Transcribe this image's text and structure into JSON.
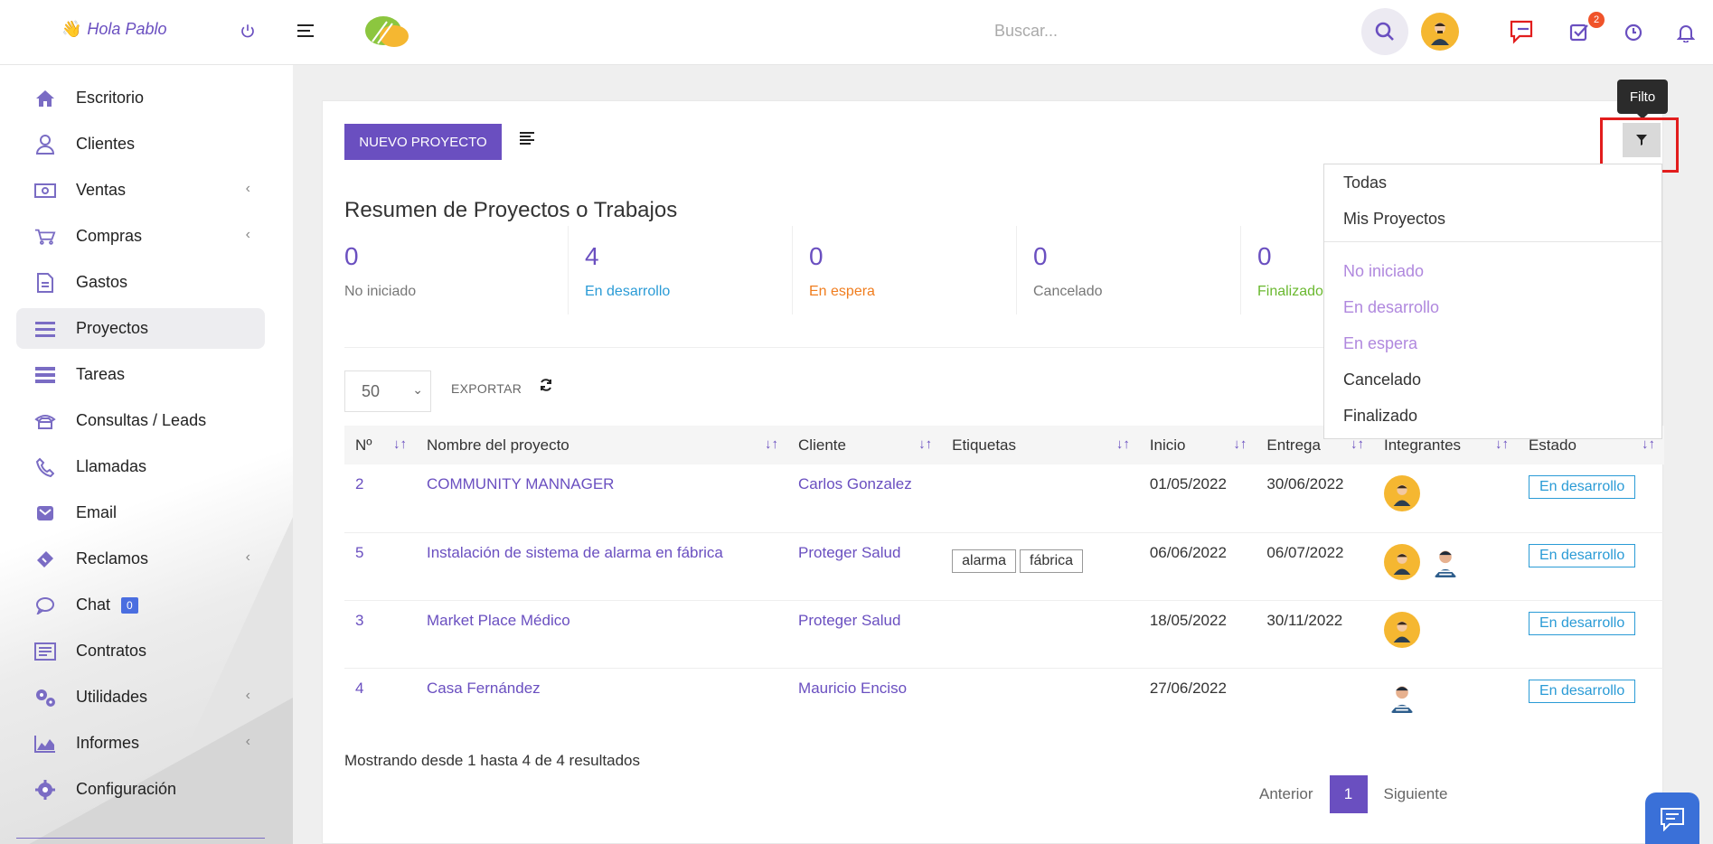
{
  "header": {
    "greeting": "Hola Pablo",
    "search_placeholder": "Buscar...",
    "tasks_badge": "2"
  },
  "sidebar": {
    "items": [
      {
        "label": "Escritorio",
        "icon": "home-icon"
      },
      {
        "label": "Clientes",
        "icon": "user-icon"
      },
      {
        "label": "Ventas",
        "icon": "money-icon"
      },
      {
        "label": "Compras",
        "icon": "cart-icon"
      },
      {
        "label": "Gastos",
        "icon": "document-icon"
      },
      {
        "label": "Proyectos",
        "icon": "bars-icon"
      },
      {
        "label": "Tareas",
        "icon": "tasks-icon"
      },
      {
        "label": "Consultas / Leads",
        "icon": "phone-icon"
      },
      {
        "label": "Llamadas",
        "icon": "call-icon"
      },
      {
        "label": "Email",
        "icon": "mail-icon"
      },
      {
        "label": "Reclamos",
        "icon": "ticket-icon"
      },
      {
        "label": "Chat",
        "icon": "chat-icon"
      },
      {
        "label": "Contratos",
        "icon": "contract-icon"
      },
      {
        "label": "Utilidades",
        "icon": "cogs-icon"
      },
      {
        "label": "Informes",
        "icon": "chart-icon"
      },
      {
        "label": "Configuración",
        "icon": "gear-icon"
      }
    ],
    "chat_count": "0"
  },
  "toolbar": {
    "new_project": "NUEVO PROYECTO",
    "filter_tooltip": "Filto"
  },
  "summary": {
    "title": "Resumen de Proyectos o Trabajos",
    "stats": [
      {
        "value": "0",
        "label": "No iniciado",
        "color": "#777777"
      },
      {
        "value": "4",
        "label": "En desarrollo",
        "color": "#2a9bd6"
      },
      {
        "value": "0",
        "label": "En espera",
        "color": "#f07d1e"
      },
      {
        "value": "0",
        "label": "Cancelado",
        "color": "#777777"
      },
      {
        "value": "0",
        "label": "Finalizado",
        "color": "#6ab82f"
      }
    ]
  },
  "controls": {
    "page_size": "50",
    "export": "EXPORTAR"
  },
  "table": {
    "columns": [
      "Nº",
      "Nombre del proyecto",
      "Cliente",
      "Etiquetas",
      "Inicio",
      "Entrega",
      "Integrantes",
      "Estado"
    ],
    "rows": [
      {
        "id": "2",
        "name": "COMMUNITY MANNAGER",
        "client": "Carlos Gonzalez",
        "tags": [],
        "start": "01/05/2022",
        "due": "30/06/2022",
        "state": "En desarrollo"
      },
      {
        "id": "5",
        "name": "Instalación de sistema de alarma en fábrica",
        "client": "Proteger Salud",
        "tags": [
          "alarma",
          "fábrica"
        ],
        "start": "06/06/2022",
        "due": "06/07/2022",
        "state": "En desarrollo"
      },
      {
        "id": "3",
        "name": "Market Place Médico",
        "client": "Proteger Salud",
        "tags": [],
        "start": "18/05/2022",
        "due": "30/11/2022",
        "state": "En desarrollo"
      },
      {
        "id": "4",
        "name": "Casa Fernández",
        "client": "Mauricio Enciso",
        "tags": [],
        "start": "27/06/2022",
        "due": "",
        "state": "En desarrollo"
      }
    ]
  },
  "footer": {
    "showing": "Mostrando desde 1 hasta 4 de 4 resultados",
    "prev": "Anterior",
    "page": "1",
    "next": "Siguiente"
  },
  "filter_menu": {
    "items": [
      "Todas",
      "Mis Proyectos"
    ],
    "status_items": [
      "No iniciado",
      "En desarrollo",
      "En espera",
      "Cancelado",
      "Finalizado"
    ]
  },
  "colors": {
    "accent": "#6a4fc0",
    "state_blue": "#2a9bd6",
    "highlight_red": "#e21d1d"
  }
}
